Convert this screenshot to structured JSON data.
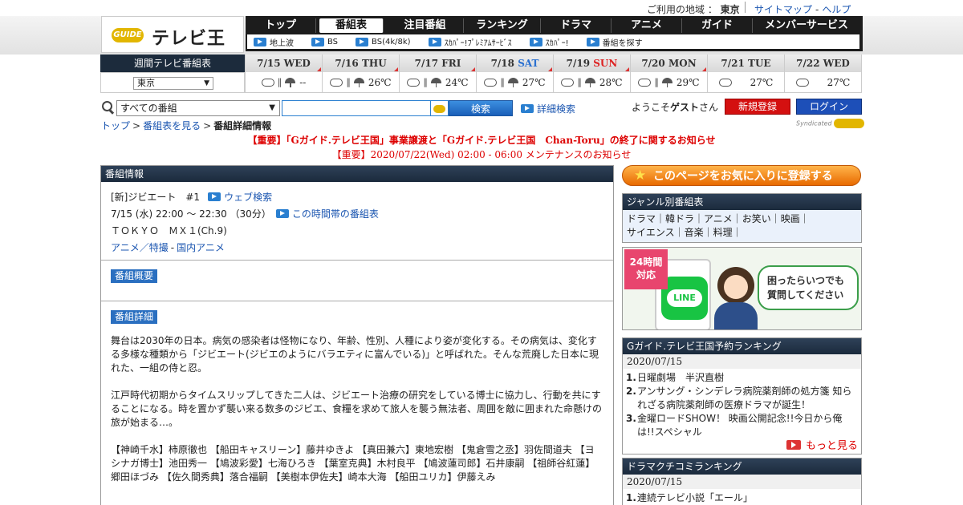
{
  "top": {
    "region_label": "ご利用の地域 ：",
    "region_value": "東京",
    "sitemap": "サイトマップ",
    "help": "ヘルプ"
  },
  "logo": {
    "badge": "GUIDE",
    "name": "テレビ王国"
  },
  "nav": {
    "tabs": [
      "トップ",
      "番組表",
      "注目番組",
      "ランキング",
      "ドラマ",
      "アニメ",
      "ガイド",
      "メンバーサービス"
    ],
    "sub": [
      "地上波",
      "BS",
      "BS(4k/8k)",
      "ｽｶﾊﾟｰ!ﾌﾟﾚﾐｱﾑｻｰﾋﾞｽ",
      "ｽｶﾊﾟｰ!",
      "番組を探す"
    ]
  },
  "week": {
    "label": "週間テレビ番組表",
    "area_select": "東京",
    "days": [
      {
        "date": "7/15",
        "wd": "WED",
        "temp": "--",
        "rain": true
      },
      {
        "date": "7/16",
        "wd": "THU",
        "temp": "26℃",
        "rain": true
      },
      {
        "date": "7/17",
        "wd": "FRI",
        "temp": "24℃",
        "rain": true
      },
      {
        "date": "7/18",
        "wd": "SAT",
        "temp": "27℃",
        "rain": true
      },
      {
        "date": "7/19",
        "wd": "SUN",
        "temp": "28℃",
        "rain": true
      },
      {
        "date": "7/20",
        "wd": "MON",
        "temp": "29℃",
        "rain": true
      },
      {
        "date": "7/21",
        "wd": "TUE",
        "temp": "27℃",
        "rain": false
      },
      {
        "date": "7/22",
        "wd": "WED",
        "temp": "27℃",
        "rain": false
      }
    ]
  },
  "search": {
    "category": "すべての番組",
    "button": "検索",
    "advanced": "詳細検索",
    "welcome_pre": "ようこそ",
    "welcome_user": "ゲスト",
    "welcome_post": "さん",
    "register": "新規登録",
    "login": "ログイン"
  },
  "breadcrumb": {
    "top": "トップ",
    "schedule": "番組表を見る",
    "current": "番組詳細情報"
  },
  "syndicated": "Syndicated",
  "notices": {
    "first": "【重要】「Gガイド.テレビ王国」事業譲渡と「Gガイド.テレビ王国　Chan-Toru」の終了に関するお知らせ",
    "second": "【重要】2020/07/22(Wed) 02:00 - 06:00 メンテナンスのお知らせ"
  },
  "program": {
    "header": "番組情報",
    "title": "[新]ジビエート　#1",
    "web_search": "ウェブ検索",
    "time": "7/15 (水) 22:00 ～ 22:30 （30分）",
    "timeslot_link": "この時間帯の番組表",
    "channel": "ＴＯＫＹＯ　ＭＸ１(Ch.9)",
    "genre_main": "アニメ／特撮",
    "genre_sub": "国内アニメ",
    "summary_tag": "番組概要",
    "detail_tag": "番組詳細",
    "detail_p1": "舞台は2030年の日本。病気の感染者は怪物になり、年齢、性別、人種により姿が変化する。その病気は、変化する多様な種類から「ジビエート(ジビエのようにバラエティに富んでいる)」と呼ばれた。そんな荒廃した日本に現れた、一組の侍と忍。",
    "detail_p2": "江戸時代初期からタイムスリップしてきた二人は、ジビエート治療の研究をしている博士に協力し、行動を共にすることになる。時を置かず襲い来る数多のジビエ、食糧を求めて旅人を襲う無法者、周囲を敵に囲まれた命懸けの旅が始まる…。",
    "detail_p3": "【神崎千水】柿原徹也 【船田キャスリーン】藤井ゆきよ 【真田兼六】東地宏樹 【鬼倉雪之丞】羽佐間道夫 【ヨシナガ博士】池田秀一 【鳩波彩愛】七海ひろき 【葉室克典】木村良平 【鳩波蓮司郎】石井康嗣 【祖師谷紅蓮】郷田ほづみ 【佐久間秀典】落合福嗣 【美樹本伊佐夫】崎本大海 【船田ユリカ】伊藤えみ"
  },
  "right": {
    "favorite": "このページをお気に入りに登録する",
    "genre_header": "ジャンル別番組表",
    "genre_row1": "ドラマ｜韓ドラ｜アニメ｜お笑い｜映画｜",
    "genre_row2": "サイエンス｜音楽｜料理｜",
    "banner_24": "24時間",
    "banner_taio": "対応",
    "banner_line": "LINE",
    "banner_bubble1": "困ったらいつでも",
    "banner_bubble2": "質問してください",
    "rank1_header": "Gガイド.テレビ王国予約ランキング",
    "rank1_date": "2020/07/15",
    "rank1_items": [
      "日曜劇場　半沢直樹",
      "アンサング・シンデレラ病院薬剤師の処方箋 知られざる病院薬剤師の医療ドラマが誕生！",
      "金曜ロードSHOW！ 映画公開記念!!今日から俺は!!スペシャル"
    ],
    "more": "もっと見る",
    "rank2_header": "ドラマクチコミランキング",
    "rank2_date": "2020/07/15",
    "rank2_items": [
      "連続テレビ小説「エール」"
    ]
  }
}
